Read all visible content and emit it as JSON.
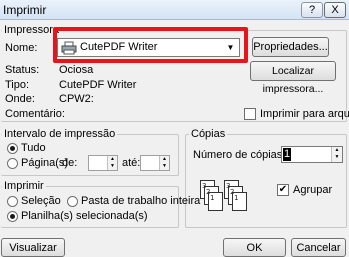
{
  "window": {
    "title": "Imprimir",
    "help_label": "?",
    "close_label": "X"
  },
  "printer": {
    "group_title": "Impressora",
    "name_label": "Nome:",
    "selected_printer": "CutePDF Writer",
    "properties_button": "Propriedades...",
    "status_label": "Status:",
    "status_value": "Ociosa",
    "type_label": "Tipo:",
    "type_value": "CutePDF Writer",
    "where_label": "Onde:",
    "where_value": "CPW2:",
    "comment_label": "Comentário:",
    "find_printer_button": "Localizar impressora...",
    "print_to_file_label": "Imprimir para arquivo",
    "print_to_file_checked": false
  },
  "range": {
    "group_title": "Intervalo de impressão",
    "all_label": "Tudo",
    "pages_label": "Página(s)",
    "from_label": "de:",
    "to_label": "até:",
    "selected": "all"
  },
  "copies": {
    "group_title": "Cópias",
    "count_label": "Número de cópias:",
    "count_value": "1",
    "collate_label": "Agrupar",
    "collate_checked": true
  },
  "print_what": {
    "group_title": "Imprimir",
    "selection_label": "Seleção",
    "workbook_label": "Pasta de trabalho inteira",
    "sheets_label": "Planilha(s) selecionada(s)",
    "selected": "sheets"
  },
  "buttons": {
    "preview": "Visualizar",
    "ok": "OK",
    "cancel": "Cancelar"
  },
  "colors": {
    "highlight": "#e8141b",
    "title_bar": "#d4e3f4"
  }
}
